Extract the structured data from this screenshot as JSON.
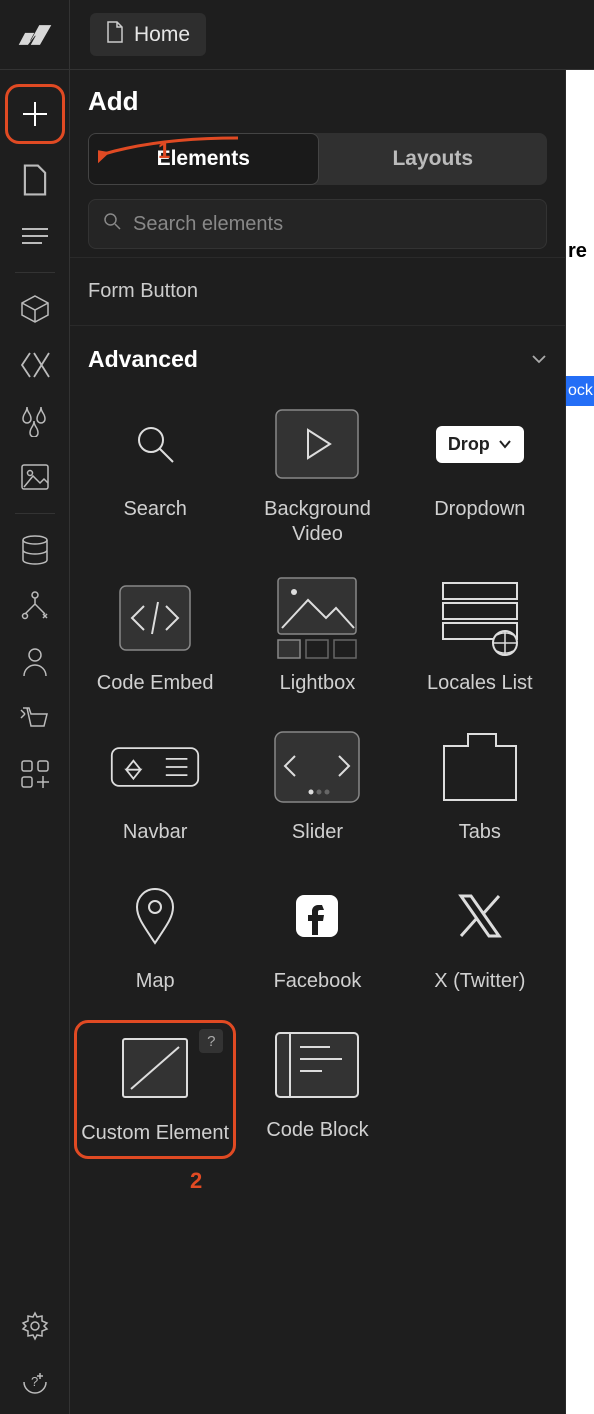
{
  "breadcrumb": {
    "page_label": "Home"
  },
  "panel": {
    "title": "Add",
    "tabs": {
      "elements": "Elements",
      "layouts": "Layouts"
    },
    "search_placeholder": "Search elements",
    "prev_section": "Form Button",
    "section_title": "Advanced",
    "items": {
      "search": "Search",
      "bg_video": "Background Video",
      "dropdown": "Dropdown",
      "dropdown_pill": "Drop",
      "code_embed": "Code Embed",
      "lightbox": "Lightbox",
      "locales": "Locales List",
      "navbar": "Navbar",
      "slider": "Slider",
      "tabs": "Tabs",
      "map": "Map",
      "facebook": "Facebook",
      "twitter": "X (Twitter)",
      "custom_element": "Custom Element",
      "code_block": "Code Block"
    },
    "help_badge": "?"
  },
  "annotations": {
    "one": "1",
    "two": "2"
  },
  "right_edge": {
    "text1": "re",
    "chip": "ock"
  }
}
